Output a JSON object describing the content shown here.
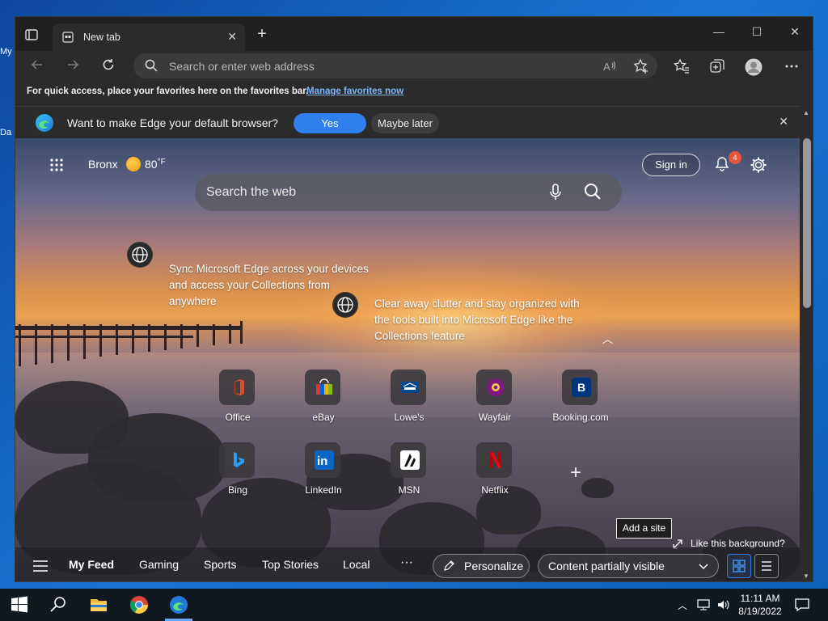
{
  "desktop": {
    "icons": [
      "My",
      "Da"
    ]
  },
  "browser": {
    "tab": {
      "title": "New tab",
      "close": "✕"
    },
    "new_tab": "+",
    "window_controls": {
      "minimize": "—",
      "maximize": "☐",
      "close": "✕"
    },
    "address_bar": {
      "placeholder": "Search or enter web address"
    },
    "favorites_bar": {
      "message": "For quick access, place your favorites here on the favorites bar.",
      "link": "Manage favorites now"
    },
    "default_prompt": {
      "question": "Want to make Edge your default browser?",
      "yes": "Yes",
      "later": "Maybe later",
      "close": "✕"
    }
  },
  "newtab": {
    "weather": {
      "city": "Bronx",
      "temperature": "80",
      "unit": "°F"
    },
    "sign_in": "Sign in",
    "notifications_count": "4",
    "search": {
      "placeholder": "Search the web"
    },
    "hint1": "Sync Microsoft Edge across your devices and access your Collections from anywhere",
    "hint2": "Clear away clutter and stay organized with the tools built into Microsoft Edge like the Collections feature",
    "tiles": [
      {
        "label": "Office",
        "icon": "office-icon",
        "color": "#d83b01"
      },
      {
        "label": "eBay",
        "icon": "ebay-icon",
        "color": "#e53238"
      },
      {
        "label": "Lowe's",
        "icon": "lowes-icon",
        "color": "#004990"
      },
      {
        "label": "Wayfair",
        "icon": "wayfair-icon",
        "color": "#7f187f"
      },
      {
        "label": "Booking.com",
        "icon": "booking-icon",
        "color": "#003580"
      },
      {
        "label": "Bing",
        "icon": "bing-icon",
        "color": "#ffffff"
      },
      {
        "label": "LinkedIn",
        "icon": "linkedin-icon",
        "color": "#0a66c2"
      },
      {
        "label": "MSN",
        "icon": "msn-icon",
        "color": "#ffffff"
      },
      {
        "label": "Netflix",
        "icon": "netflix-icon",
        "color": "#e50914"
      }
    ],
    "add_site": "Add a site",
    "like_background": "Like this background?",
    "feed": {
      "items": [
        "My Feed",
        "Gaming",
        "Sports",
        "Top Stories",
        "Local"
      ],
      "more": "···",
      "personalize": "Personalize",
      "content_visibility": "Content partially visible"
    }
  },
  "taskbar": {
    "time": "11:11 AM",
    "date": "8/19/2022"
  },
  "colors": {
    "accent": "#2f80ed",
    "badge": "#e8533c",
    "chrome_dark": "#202020",
    "toolbar": "#2b2b2b"
  }
}
